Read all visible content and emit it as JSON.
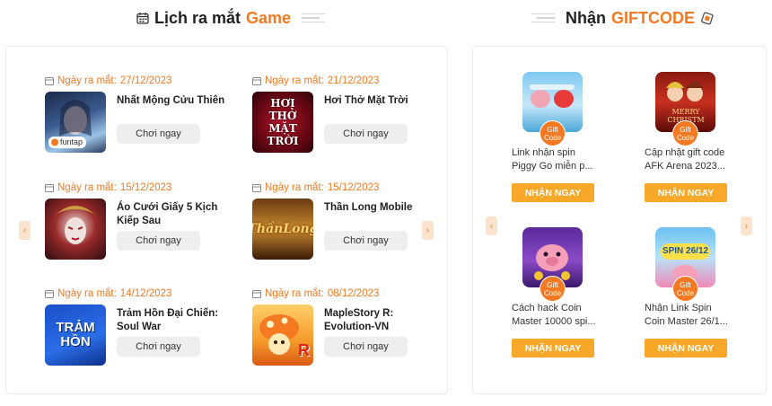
{
  "release_section": {
    "title_prefix": "Lịch ra mắt",
    "title_accent": "Game",
    "date_label": "Ngày ra mắt:",
    "items": [
      {
        "date": "27/12/2023",
        "name": "Nhất Mộng Cửu Thiên",
        "button": "Chơi ngay",
        "thumb_text": "funtap"
      },
      {
        "date": "21/12/2023",
        "name": "Hơi Thở Mặt Trời",
        "button": "Chơi ngay",
        "thumb_text": "HƠI THỞ MẶT TRỜI"
      },
      {
        "date": "15/12/2023",
        "name": "Áo Cưới Giấy 5 Kịch Kiếp Sau",
        "button": "Chơi ngay",
        "thumb_text": ""
      },
      {
        "date": "15/12/2023",
        "name": "Thần Long Mobile",
        "button": "Chơi ngay",
        "thumb_text": "ThầnLong"
      },
      {
        "date": "14/12/2023",
        "name": "Trảm Hồn Đại Chiến: Soul War",
        "button": "Chơi ngay",
        "thumb_text": "TRẢM HỒN"
      },
      {
        "date": "08/12/2023",
        "name": "MapleStory R: Evolution-VN",
        "button": "Chơi ngay",
        "thumb_text": "R"
      }
    ]
  },
  "gift_section": {
    "title_prefix": "Nhận",
    "title_accent": "GIFTCODE",
    "badge_line1": "Gift",
    "badge_line2": "Code",
    "items": [
      {
        "title": "Link nhận spin Piggy Go miễn p...",
        "button": "NHẬN NGAY",
        "thumb_text": ""
      },
      {
        "title": "Cập nhật gift code AFK Arena 2023...",
        "button": "NHẬN NGAY",
        "thumb_text": "MERRY CHRISTM"
      },
      {
        "title": "Cách hack Coin Master 10000 spi...",
        "button": "NHẬN NGAY",
        "thumb_text": ""
      },
      {
        "title": "Nhận Link Spin Coin Master 26/1...",
        "button": "NHẬN NGAY",
        "thumb_text": "SPIN 26/12"
      }
    ]
  },
  "colors": {
    "accent": "#f47920",
    "button_orange": "#f7a829",
    "arrow_bg": "#fbe3cd"
  },
  "icons": {
    "calendar": "calendar-icon",
    "gift": "gift-icon",
    "prev": "chevron-left-icon",
    "next": "chevron-right-icon"
  }
}
